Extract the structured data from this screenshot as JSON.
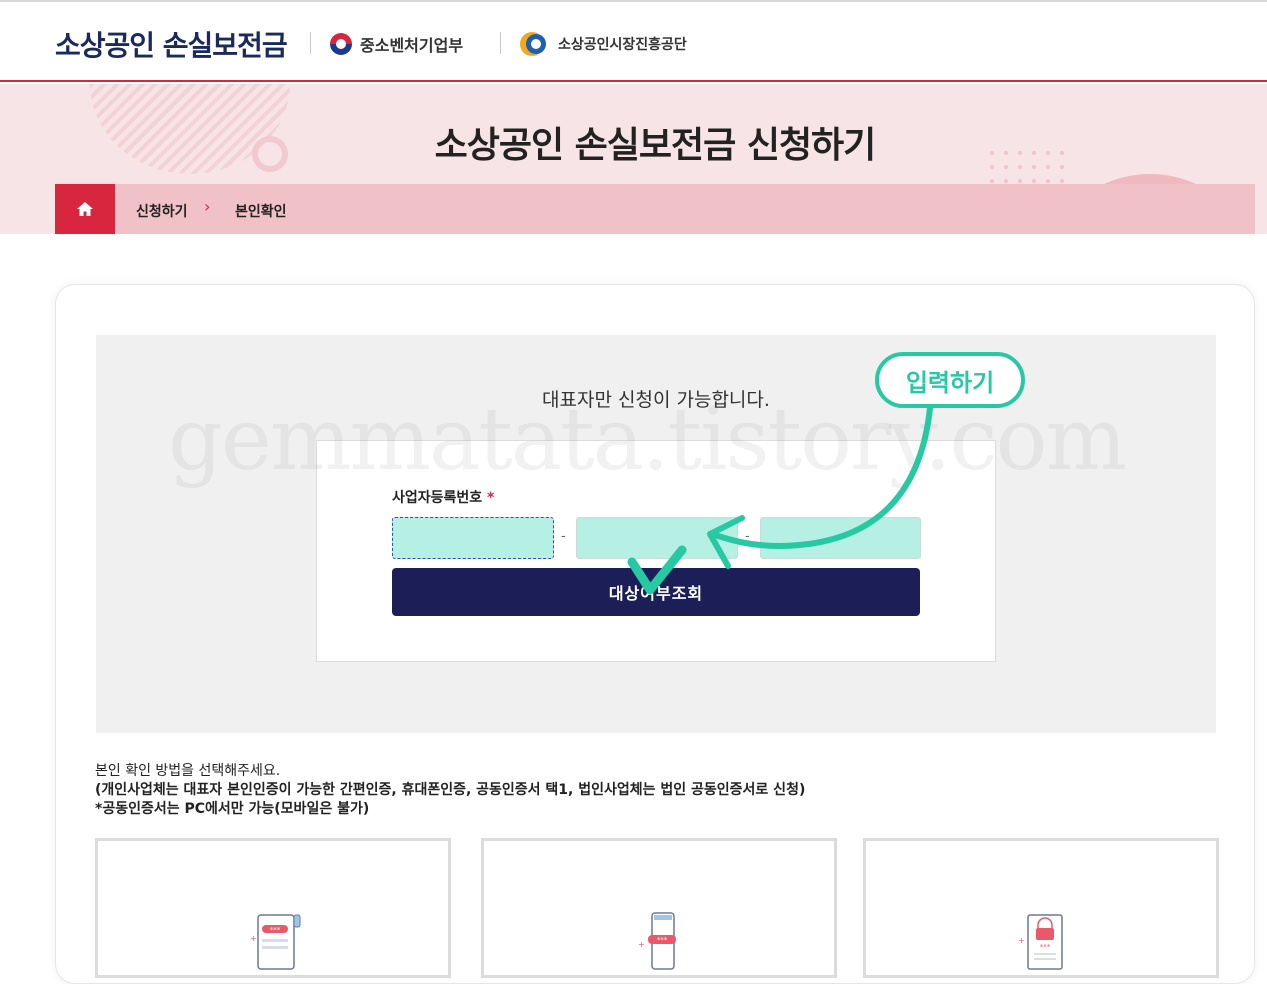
{
  "header": {
    "site_title": "소상공인 손실보전금",
    "org1": "중소벤처기업부",
    "org2": "소상공인시장진흥공단"
  },
  "banner": {
    "title": "소상공인 손실보전금 신청하기",
    "breadcrumb": [
      "신청하기",
      "본인확인"
    ],
    "home_icon": "home-icon",
    "separator": "›"
  },
  "form": {
    "notice": "대표자만 신청이 가능합니다.",
    "field_label": "사업자등록번호",
    "required_mark": "*",
    "part1_value": "",
    "part2_value": "",
    "part3_value": "",
    "dash": "-",
    "submit_label": "대상여부조회"
  },
  "annotation": {
    "bubble": "입력하기",
    "arrow_color": "#27c9a3"
  },
  "watermark": "gemmatata.tistory.com",
  "guide": {
    "line1": "본인 확인 방법을 선택해주세요.",
    "line2": "(개인사업체는 대표자 본인인증이 가능한 간편인증, 휴대폰인증, 공동인증서 택1, 법인사업체는 법인 공동인증서로 신청)",
    "line3": "*공동인증서는 PC에서만 가능(모바일은 불가)"
  },
  "methods": [
    {
      "icon": "simple-auth-document-icon"
    },
    {
      "icon": "mobile-phone-auth-icon"
    },
    {
      "icon": "certificate-lock-icon"
    }
  ],
  "colors": {
    "brand_red": "#d7263d",
    "navy": "#1c1f57",
    "input_fill": "#b6efe3",
    "accent_teal": "#27c9a3"
  }
}
